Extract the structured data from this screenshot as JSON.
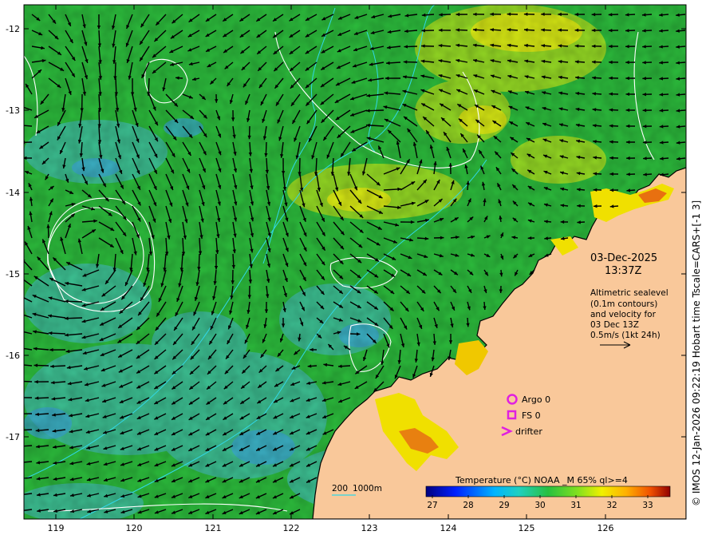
{
  "map": {
    "lat_labels": [
      "-12",
      "-13",
      "-14",
      "-15",
      "-16",
      "-17"
    ],
    "lon_labels": [
      "119",
      "120",
      "121",
      "122",
      "123",
      "124",
      "125",
      "126"
    ],
    "date": "03-Dec-2025",
    "time": "13:37Z",
    "altimetry_lines": [
      "Altimetric sealevel",
      "(0.1m contours)",
      "and velocity for",
      "03 Dec 13Z",
      "0.5m/s (1kt 24h)"
    ],
    "legend": {
      "argo": "Argo 0",
      "fs": "FS 0",
      "drifter": "drifter"
    },
    "bathy_label_a": "200",
    "bathy_label_b": "1000m",
    "colorbar": {
      "title": "Temperature (°C) NOAA _M 65% ql>=4",
      "ticks": [
        "27",
        "28",
        "29",
        "30",
        "31",
        "32",
        "33"
      ]
    },
    "credit": "© IMOS 12-Jan-2026 09:22:19 Hobart time Tscale=CARS+[-1 3]",
    "colors": {
      "land": "#f9c89a",
      "sea_base": "#2fbf3d",
      "contour": "#ffffff",
      "isobath": "#30d8e8",
      "marker": "#e020e0"
    }
  }
}
